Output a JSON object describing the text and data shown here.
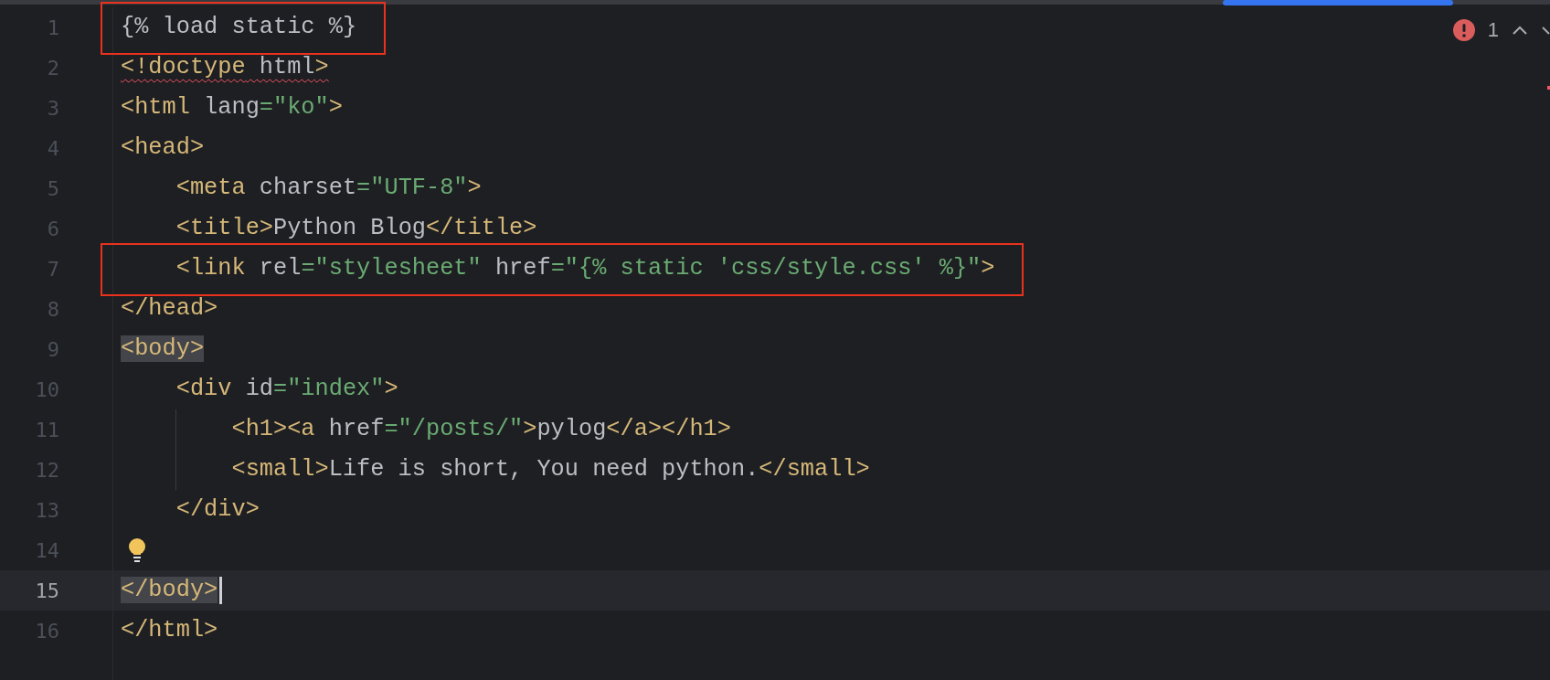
{
  "inspection": {
    "errors": "1"
  },
  "lines": [
    {
      "number": "1",
      "current": false,
      "annotated": true,
      "error": false,
      "tokens": [
        {
          "kind": "template",
          "text": "{% load static %}",
          "matched": false
        }
      ]
    },
    {
      "number": "2",
      "current": false,
      "annotated": false,
      "error": true,
      "tokens": [
        {
          "kind": "tag",
          "text": "<!doctype",
          "matched": false
        },
        {
          "kind": "attr",
          "text": " html",
          "matched": false
        },
        {
          "kind": "tag",
          "text": ">",
          "matched": false
        }
      ]
    },
    {
      "number": "3",
      "current": false,
      "annotated": false,
      "error": false,
      "tokens": [
        {
          "kind": "tag",
          "text": "<html",
          "matched": false
        },
        {
          "kind": "attr",
          "text": " lang",
          "matched": false
        },
        {
          "kind": "string",
          "text": "=\"ko\"",
          "matched": false
        },
        {
          "kind": "tag",
          "text": ">",
          "matched": false
        }
      ]
    },
    {
      "number": "4",
      "current": false,
      "annotated": false,
      "error": false,
      "tokens": [
        {
          "kind": "tag",
          "text": "<head>",
          "matched": false
        }
      ]
    },
    {
      "number": "5",
      "current": false,
      "annotated": false,
      "error": false,
      "tokens": [
        {
          "kind": "tag",
          "text": "    <meta",
          "matched": false
        },
        {
          "kind": "attr",
          "text": " charset",
          "matched": false
        },
        {
          "kind": "string",
          "text": "=\"UTF-8\"",
          "matched": false
        },
        {
          "kind": "tag",
          "text": ">",
          "matched": false
        }
      ]
    },
    {
      "number": "6",
      "current": false,
      "annotated": false,
      "error": false,
      "tokens": [
        {
          "kind": "tag",
          "text": "    <title>",
          "matched": false
        },
        {
          "kind": "text",
          "text": "Python Blog",
          "matched": false
        },
        {
          "kind": "tag",
          "text": "</title>",
          "matched": false
        }
      ]
    },
    {
      "number": "7",
      "current": false,
      "annotated": true,
      "error": false,
      "tokens": [
        {
          "kind": "tag",
          "text": "    <link",
          "matched": false
        },
        {
          "kind": "attr",
          "text": " rel",
          "matched": false
        },
        {
          "kind": "string",
          "text": "=\"stylesheet\"",
          "matched": false
        },
        {
          "kind": "attr",
          "text": " href",
          "matched": false
        },
        {
          "kind": "string",
          "text": "=\"{% static 'css/style.css' %}\"",
          "matched": false
        },
        {
          "kind": "tag",
          "text": ">",
          "matched": false
        }
      ]
    },
    {
      "number": "8",
      "current": false,
      "annotated": false,
      "error": false,
      "tokens": [
        {
          "kind": "tag",
          "text": "</head>",
          "matched": false
        }
      ]
    },
    {
      "number": "9",
      "current": false,
      "annotated": false,
      "error": false,
      "tokens": [
        {
          "kind": "tag",
          "text": "<body>",
          "matched": true
        }
      ]
    },
    {
      "number": "10",
      "current": false,
      "annotated": false,
      "error": false,
      "tokens": [
        {
          "kind": "tag",
          "text": "    <div",
          "matched": false
        },
        {
          "kind": "attr",
          "text": " id",
          "matched": false
        },
        {
          "kind": "string",
          "text": "=\"index\"",
          "matched": false
        },
        {
          "kind": "tag",
          "text": ">",
          "matched": false
        }
      ]
    },
    {
      "number": "11",
      "current": false,
      "annotated": false,
      "error": false,
      "tokens": [
        {
          "kind": "tag",
          "text": "        <h1><a",
          "matched": false
        },
        {
          "kind": "attr",
          "text": " href",
          "matched": false
        },
        {
          "kind": "string",
          "text": "=\"/posts/\"",
          "matched": false
        },
        {
          "kind": "tag",
          "text": ">",
          "matched": false
        },
        {
          "kind": "text",
          "text": "pylog",
          "matched": false
        },
        {
          "kind": "tag",
          "text": "</a></h1>",
          "matched": false
        }
      ]
    },
    {
      "number": "12",
      "current": false,
      "annotated": false,
      "error": false,
      "tokens": [
        {
          "kind": "tag",
          "text": "        <small>",
          "matched": false
        },
        {
          "kind": "text",
          "text": "Life is short, You need python.",
          "matched": false
        },
        {
          "kind": "tag",
          "text": "</small>",
          "matched": false
        }
      ]
    },
    {
      "number": "13",
      "current": false,
      "annotated": false,
      "error": false,
      "tokens": [
        {
          "kind": "tag",
          "text": "    </div>",
          "matched": false
        }
      ]
    },
    {
      "number": "14",
      "current": false,
      "hint": true
    },
    {
      "number": "15",
      "current": true,
      "annotated": false,
      "error": false,
      "tokens": [
        {
          "kind": "tag",
          "text": "</body>",
          "matched": true
        }
      ]
    },
    {
      "number": "16",
      "current": false,
      "annotated": false,
      "error": false,
      "tokens": [
        {
          "kind": "tag",
          "text": "</html>",
          "matched": false
        }
      ]
    }
  ]
}
